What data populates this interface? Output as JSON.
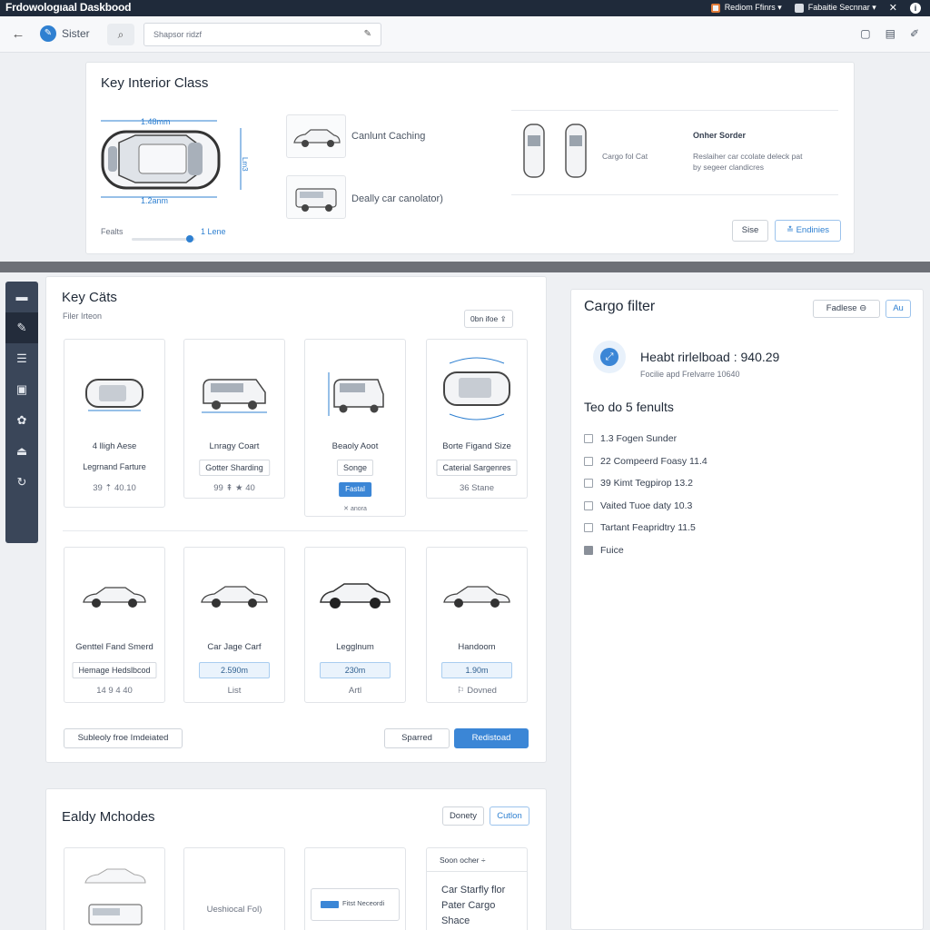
{
  "titlebar": {
    "app_title": "Frdowologıaal Daskbood",
    "user_menu": "Rediom Ffinrs ▾",
    "account_menu": "Fabaitie Secnnar ▾",
    "close": "✕",
    "info": "i"
  },
  "toolbar": {
    "back": "←",
    "brand_label": "Sister",
    "brand_glyph": "✎",
    "search_button_icon": "⌕",
    "search_placeholder": "Shapsor ridzf",
    "search_glyph": "✎"
  },
  "top_panel": {
    "title": "Key Interior Class",
    "dim_top": "1.48mm",
    "dim_bottom": "1.2anm",
    "dim_side": "Lm3",
    "slider_label": "Fealts",
    "slider_value_label": "1 Lene",
    "slider_fraction": 0.92,
    "option_1_label": "Canlunt Caching",
    "option_2_label": "Deally car canolator)",
    "pair_label": "Cargo fol Cat",
    "side_title": "Onher Sorder",
    "side_text_line1": "Reslaiher car ccolate deleck pat",
    "side_text_line2": "by segeer clandicres",
    "btn_size": "Sise",
    "btn_endinies": "≛ Endinies"
  },
  "rail": {
    "items": [
      "▬",
      "✎",
      "☰",
      "▣",
      "✿",
      "⏏",
      "↻"
    ]
  },
  "cards_panel": {
    "title": "Key Cäts",
    "subtitle": "Filer Irteon",
    "dropdown": "0bn ifoe  ⇪",
    "row1": [
      {
        "name": "4 lligh Aese",
        "tag": "Legrnand Farture",
        "foot": "39  ⇡ 40.10"
      },
      {
        "name": "Lnragy Coart",
        "tag": "Gotter Sharding",
        "foot": "99  ⇞  ★ 40"
      },
      {
        "name": "Beaoly Aoot",
        "tag": "Songe",
        "badge": "Fastal",
        "foot": "✕  anora"
      },
      {
        "name": "Borte Figand Size",
        "tag": "Caterial Sargenres",
        "foot": "36 Stane"
      }
    ],
    "row2": [
      {
        "name": "Genttel Fand Smerd",
        "tag": "Hemage Hedslbcod",
        "foot": "14  9 4 40"
      },
      {
        "name": "Car Jage Carf",
        "tag": "2.590m",
        "foot": "List"
      },
      {
        "name": "Legglnum",
        "tag": "230m",
        "foot": "Artl"
      },
      {
        "name": "Handoom",
        "tag": "1.90m",
        "foot": "⚐ Dovned"
      }
    ],
    "btn_left": "Subleoly froe Imdeiated",
    "btn_mid": "Sparred",
    "btn_primary": "Redistoad"
  },
  "right_panel": {
    "title": "Cargo filter",
    "filter_button": "Fadlese  ⊖",
    "ab_button": "Au",
    "stat_main": "Heabt rirlelboad : 940.29",
    "stat_sub": "Focilie apd Frelvarre 10640",
    "badge_glyph": "⤢",
    "results_title": "Teo do 5 fenults",
    "results": [
      {
        "label": "1.3 Fogen Sunder",
        "checked": false
      },
      {
        "label": "22 Compeerd Foasy 11.4",
        "checked": false
      },
      {
        "label": "39 Kimt Tegpirop 13.2",
        "checked": false
      },
      {
        "label": "Vaited Tuoe daty 10.3",
        "checked": false
      },
      {
        "label": "Tartant Feapridtry 11.5",
        "checked": false
      },
      {
        "label": "Fuice",
        "checked": true
      }
    ]
  },
  "bottom_panel": {
    "title": "Ealdy Mchodes",
    "btn_1": "Donety",
    "btn_2": "Cutlon",
    "tile2_text": "Ueshiocal Fol)",
    "tile3_chip": "Fitst Neceordi",
    "tile4_head": "Soon ocher   ÷",
    "tile4_line1": "Car Starfly flor",
    "tile4_line2": "Pater Cargo",
    "tile4_line3": "Shace"
  },
  "colors": {
    "titlebar_bg": "#1f2a3a",
    "accent": "#3b86d6",
    "rail_bg": "#3a4659",
    "band": "#6d7077"
  }
}
